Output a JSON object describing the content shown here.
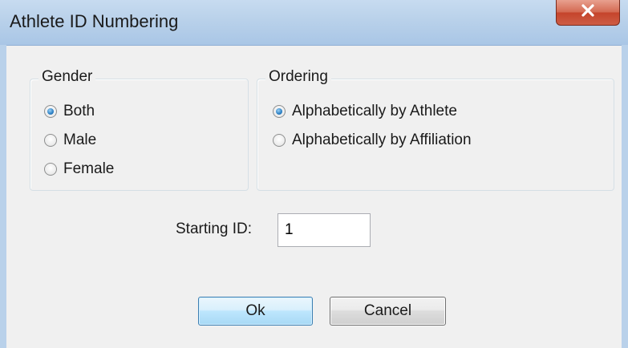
{
  "window": {
    "title": "Athlete ID Numbering",
    "close_glyph": "X"
  },
  "gender_group": {
    "legend": "Gender",
    "options": [
      {
        "label": "Both",
        "checked": true
      },
      {
        "label": "Male",
        "checked": false
      },
      {
        "label": "Female",
        "checked": false
      }
    ]
  },
  "ordering_group": {
    "legend": "Ordering",
    "options": [
      {
        "label": "Alphabetically by Athlete",
        "checked": true
      },
      {
        "label": "Alphabetically by Affiliation",
        "checked": false
      }
    ]
  },
  "starting_id": {
    "label": "Starting ID:",
    "value": "1"
  },
  "buttons": {
    "ok_label": "Ok",
    "cancel_label": "Cancel"
  },
  "colors": {
    "titlebar": "#b9d1ea",
    "close_button": "#c5442b",
    "radio_selected": "#2b7fc3",
    "ok_border": "#3c7fb1"
  }
}
